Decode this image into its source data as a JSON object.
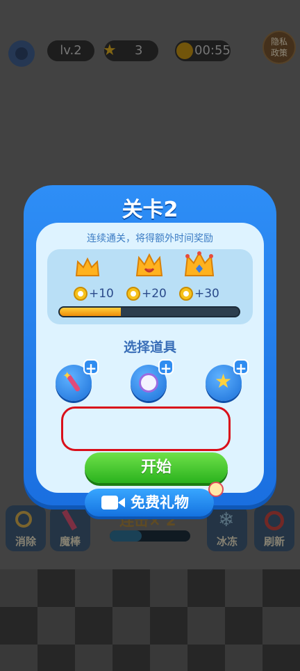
{
  "hud": {
    "level": "lv.2",
    "stars": "3",
    "timer": "00:55",
    "privacy_line1": "隐私",
    "privacy_line2": "政策"
  },
  "dialog": {
    "title": "关卡2",
    "subtitle": "连续通关，将得额外时间奖励",
    "rewards": [
      {
        "bonus": "+10"
      },
      {
        "bonus": "+20"
      },
      {
        "bonus": "+30"
      }
    ],
    "progress": 0.34,
    "section_label": "选择道具",
    "items": [
      {
        "icon": "magic-wand-icon"
      },
      {
        "icon": "clock-icon"
      },
      {
        "icon": "star-icon"
      }
    ],
    "start_label": "开始",
    "gift_label": "免费礼物"
  },
  "background": {
    "combo": "连击× 2",
    "tools": [
      {
        "label": "消除"
      },
      {
        "label": "魔棒"
      },
      {
        "label": "冰冻"
      },
      {
        "label": "刷新"
      }
    ]
  },
  "colors": {
    "dialog_blue": "#2e8ef6",
    "panel": "#def3ff",
    "start_green": "#2ab21e",
    "highlight_red": "#d90f1a",
    "progress_orange": "#ee8e0a"
  }
}
